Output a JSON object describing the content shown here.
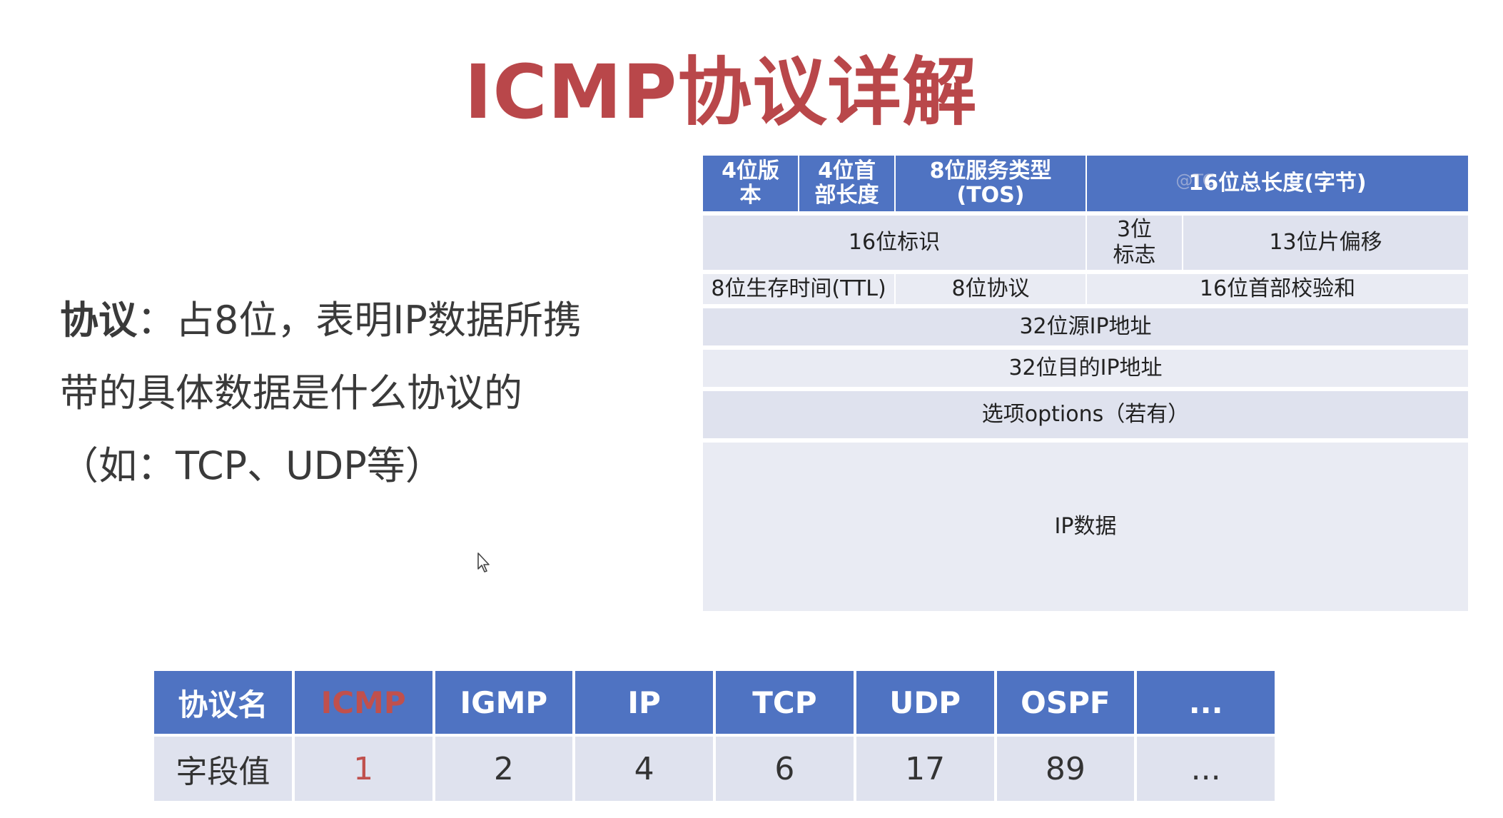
{
  "slide": {
    "title": "ICMP协议详解",
    "description": {
      "keyword": "协议",
      "line1_rest": "：占8位，表明IP数据所携",
      "line2": "带的具体数据是什么协议的",
      "line3": "（如：TCP、UDP等）"
    }
  },
  "ip_header": {
    "row1": [
      "4位版本",
      "4位首部长度",
      "8位服务类型(TOS)",
      "16位总长度(字节)"
    ],
    "row1_lines": [
      [
        "4位版",
        "本"
      ],
      [
        "4位首",
        "部长度"
      ],
      [
        "8位服务类型",
        "(TOS)"
      ]
    ],
    "row2": [
      "16位标识",
      "3位标志",
      "13位片偏移"
    ],
    "row2_flag_lines": [
      "3位",
      "标志"
    ],
    "row3": [
      "8位生存时间(TTL)",
      "8位协议",
      "16位首部校验和"
    ],
    "row4": "32位源IP地址",
    "row5": "32位目的IP地址",
    "row6": "选项options（若有）",
    "row7": "IP数据",
    "watermark": "@TC"
  },
  "protocol_table": {
    "header_label": "协议名",
    "value_label": "字段值",
    "columns": [
      {
        "name": "ICMP",
        "value": "1"
      },
      {
        "name": "IGMP",
        "value": "2"
      },
      {
        "name": "IP",
        "value": "4"
      },
      {
        "name": "TCP",
        "value": "6"
      },
      {
        "name": "UDP",
        "value": "17"
      },
      {
        "name": "OSPF",
        "value": "89"
      },
      {
        "name": "...",
        "value": "..."
      }
    ]
  },
  "colors": {
    "title": "#b9474a",
    "header_blue": "#4f73c2",
    "cell_light": "#dfe2ee",
    "highlight_red": "#c0504d"
  }
}
